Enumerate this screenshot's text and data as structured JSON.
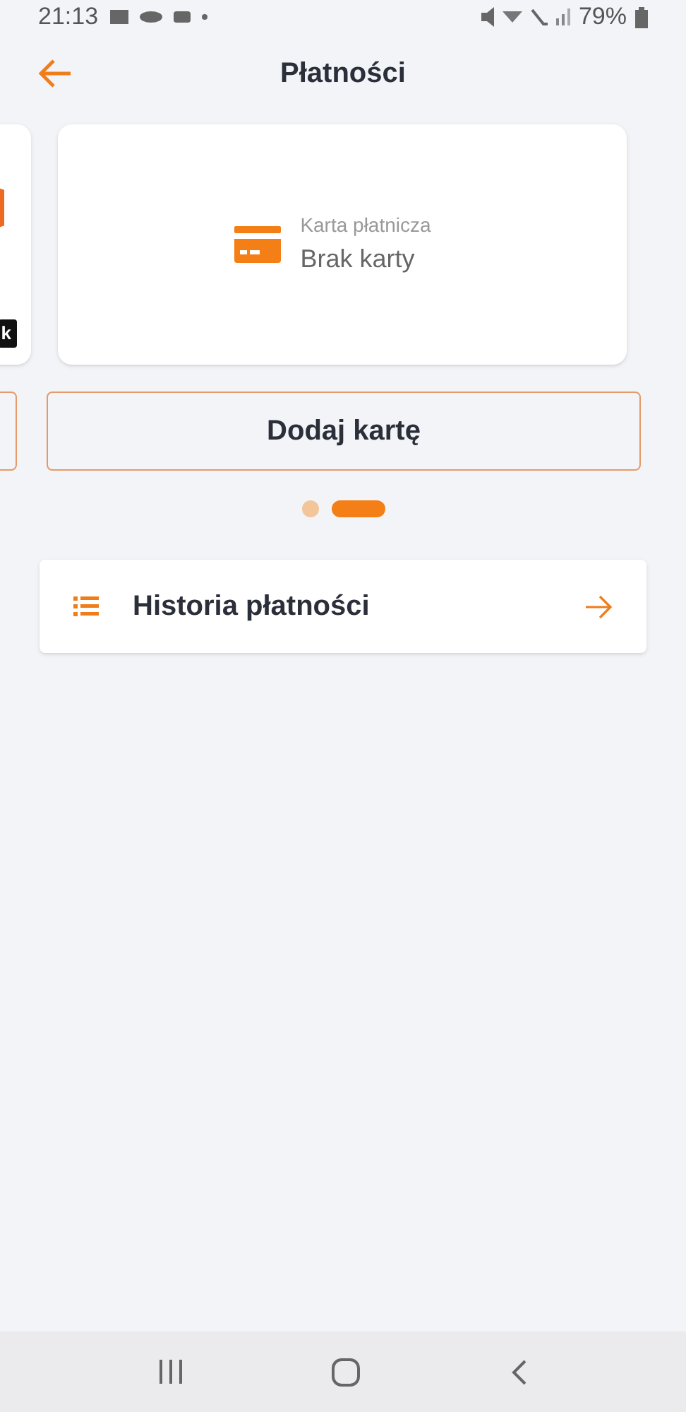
{
  "status_bar": {
    "time": "21:13",
    "battery": "79%"
  },
  "header": {
    "title": "Płatności"
  },
  "cards": [
    {
      "kind": "partial",
      "badge": "k"
    },
    {
      "kind": "card",
      "label": "Karta płatnicza",
      "value": "Brak karty"
    }
  ],
  "buttons": [
    {
      "kind": "partial"
    },
    {
      "kind": "button",
      "label": "Dodaj kartę"
    }
  ],
  "pages": [
    {
      "selected": false
    },
    {
      "selected": true
    }
  ],
  "menu": [
    {
      "label": "Historia płatności"
    }
  ]
}
